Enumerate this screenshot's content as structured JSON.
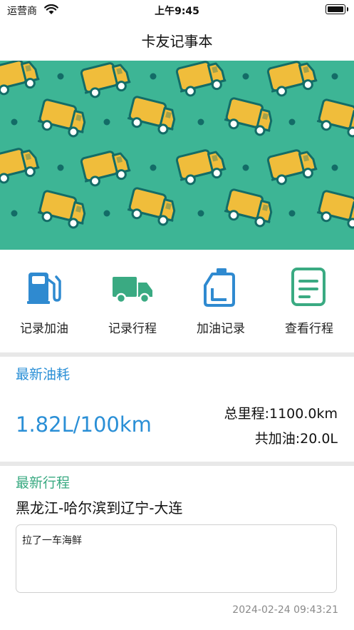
{
  "status_bar": {
    "carrier": "运营商",
    "time": "上午9:45"
  },
  "nav": {
    "title": "卡友记事本"
  },
  "banner": {
    "background": "#3db595",
    "truck_color": "#f0bd3b",
    "dot_color": "#136c67"
  },
  "actions": [
    {
      "label": "记录加油",
      "icon": "fuel-pump-icon",
      "color": "#2f8ad0"
    },
    {
      "label": "记录行程",
      "icon": "truck-icon",
      "color": "#3aaa82"
    },
    {
      "label": "加油记录",
      "icon": "oil-canister-icon",
      "color": "#2f8ad0"
    },
    {
      "label": "查看行程",
      "icon": "document-icon",
      "color": "#3aaa82"
    }
  ],
  "fuel": {
    "title": "最新油耗",
    "consumption": "1.82L/100km",
    "total_mileage": "总里程:1100.0km",
    "total_fuel": "共加油:20.0L"
  },
  "trip": {
    "title": "最新行程",
    "route": "黑龙江-哈尔滨到辽宁-大连",
    "note": "拉了一车海鲜",
    "time": "2024-02-24 09:43:21"
  },
  "colors": {
    "blue": "#2a8fd6",
    "green": "#3aaa82",
    "divider": "#e8e8e8"
  }
}
